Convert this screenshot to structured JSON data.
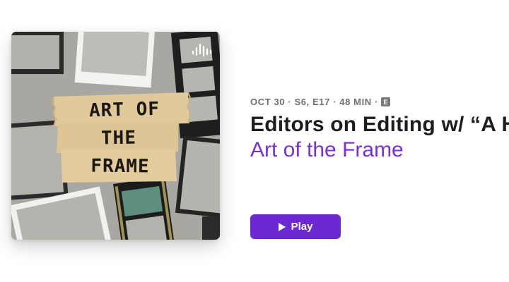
{
  "episode": {
    "meta_text": "OCT 30 · S6, E17 · 48 MIN ·",
    "explicit_badge": "E",
    "title": "Editors on Editing w/ “A H",
    "show_name": "Art of the Frame"
  },
  "artwork": {
    "cover_lines": [
      "ART OF",
      "THE",
      "FRAME"
    ],
    "icon": "anchor-podcast-icon"
  },
  "play_button": {
    "label": "Play",
    "icon": "play-icon"
  },
  "colors": {
    "accent": "#6b28d3",
    "show_name": "#7b2fd6",
    "meta": "#6e6e73",
    "title": "#1d1d1f"
  }
}
